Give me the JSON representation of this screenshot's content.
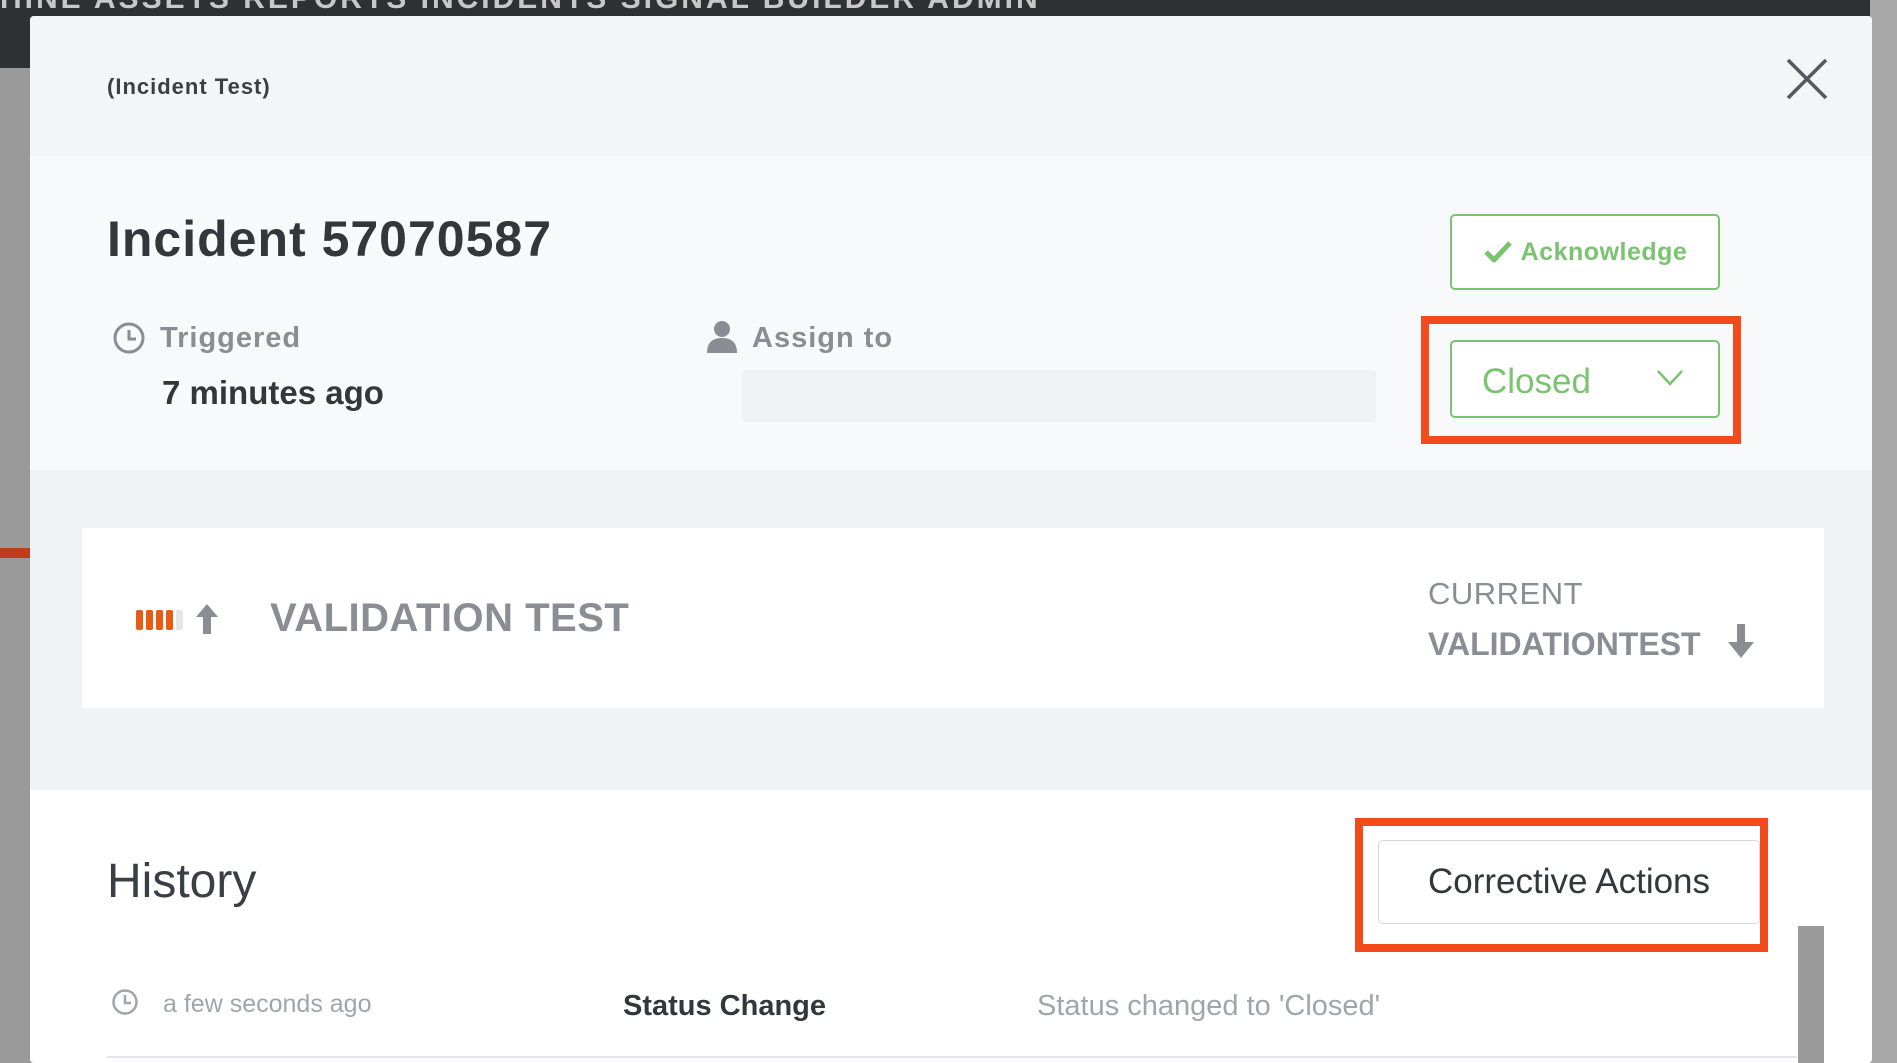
{
  "background": {
    "nav_text": "HINE   ASSETS   REPORTS   INCIDENTS   SIGNAL BUILDER   ADMIN"
  },
  "modal": {
    "subtitle": "(Incident Test)",
    "close_icon": "close-icon"
  },
  "incident": {
    "title": "Incident 57070587",
    "triggered_label": "Triggered",
    "triggered_value": "7 minutes ago",
    "assign_label": "Assign to",
    "assign_value": "",
    "acknowledge_label": "Acknowledge",
    "status_value": "Closed"
  },
  "signal": {
    "name": "VALIDATION TEST",
    "current_label": "CURRENT",
    "current_value": "VALIDATIONTEST",
    "severity_level": 4,
    "severity_max": 5
  },
  "history": {
    "title": "History",
    "corrective_actions_label": "Corrective Actions",
    "rows": [
      {
        "time": "a few seconds ago",
        "type": "Status Change",
        "detail": "Status changed to 'Closed'"
      }
    ]
  },
  "colors": {
    "accent_green": "#7ac36f",
    "highlight_red": "#f24a1a",
    "severity_orange": "#e85b12"
  },
  "icons": [
    "close-icon",
    "clock-icon",
    "user-icon",
    "check-icon",
    "chevron-down-icon",
    "severity-bars-icon",
    "arrow-up-icon",
    "arrow-down-icon"
  ]
}
